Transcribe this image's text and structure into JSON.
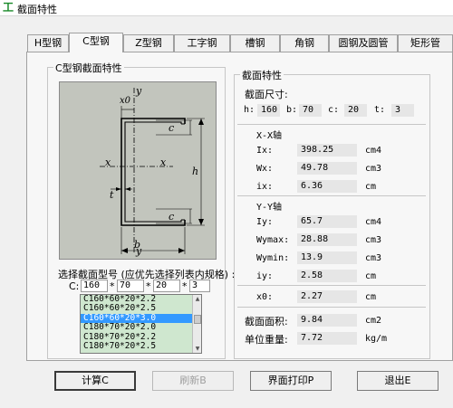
{
  "window": {
    "title": "截面特性"
  },
  "tabs": [
    {
      "label": "H型钢"
    },
    {
      "label": "C型钢"
    },
    {
      "label": "Z型钢"
    },
    {
      "label": "工字钢"
    },
    {
      "label": "槽钢"
    },
    {
      "label": "角钢"
    },
    {
      "label": "圆钢及圆管"
    },
    {
      "label": "矩形管"
    }
  ],
  "left_group": {
    "title": "C型钢截面特性",
    "figure_labels": {
      "y_top": "y",
      "y_bottom": "y",
      "x_left": "x",
      "x_right": "x",
      "xo": "x0",
      "c_top": "c",
      "c_bottom": "c",
      "h": "h",
      "t": "t",
      "b": "b"
    },
    "select_label": "选择截面型号 (应优先选择列表内规格) :",
    "c_label": "C:",
    "separator": "*",
    "inputs": {
      "h": "160",
      "b": "70",
      "c": "20",
      "t": "3"
    },
    "list_items": [
      "C160*60*20*2.2",
      "C160*60*20*2.5",
      "C160*60*20*3.0",
      "C180*70*20*2.0",
      "C180*70*20*2.2",
      "C180*70*20*2.5"
    ],
    "selected_index": 2
  },
  "right_group": {
    "title": "截面特性",
    "dims_title": "截面尺寸:",
    "dims": {
      "h_label": "h:",
      "h": "160",
      "b_label": "b:",
      "b": "70",
      "c_label": "c:",
      "c": "20",
      "t_label": "t:",
      "t": "3"
    },
    "xx_title": "X-X轴",
    "Ix": {
      "label": "Ix:",
      "value": "398.25",
      "unit": "cm4"
    },
    "Wx": {
      "label": "Wx:",
      "value": "49.78",
      "unit": "cm3"
    },
    "ix": {
      "label": "ix:",
      "value": "6.36",
      "unit": "cm"
    },
    "yy_title": "Y-Y轴",
    "Iy": {
      "label": "Iy:",
      "value": "65.7",
      "unit": "cm4"
    },
    "Wymax": {
      "label": "Wymax:",
      "value": "28.88",
      "unit": "cm3"
    },
    "Wymin": {
      "label": "Wymin:",
      "value": "13.9",
      "unit": "cm3"
    },
    "iy": {
      "label": "iy:",
      "value": "2.58",
      "unit": "cm"
    },
    "x0": {
      "label": "x0:",
      "value": "2.27",
      "unit": "cm"
    },
    "area": {
      "label": "截面面积:",
      "value": "9.84",
      "unit": "cm2"
    },
    "weight": {
      "label": "单位重量:",
      "value": "7.72",
      "unit": "kg/m"
    }
  },
  "buttons": {
    "calc": "计算C",
    "refresh": "刷新B",
    "print": "界面打印P",
    "exit": "退出E"
  }
}
